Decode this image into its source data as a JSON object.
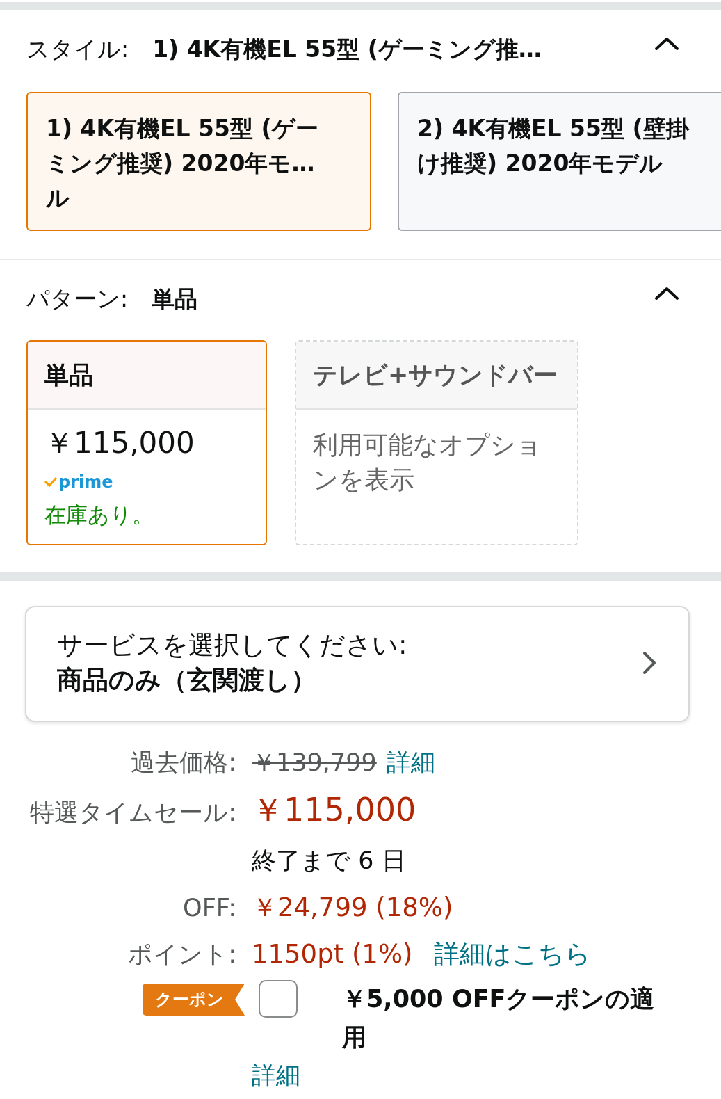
{
  "style_section": {
    "label": "スタイル:",
    "value": "1) 4K有機EL 55型 (ゲーミング推…",
    "expanded": true,
    "options": [
      {
        "text": "1) 4K有機EL 55型 (ゲーミング推奨) 2020年モ…ル",
        "selected": true
      },
      {
        "text": "2) 4K有機EL 55型 (壁掛け推奨) 2020年モデル",
        "selected": false
      }
    ]
  },
  "pattern_section": {
    "label": "パターン:",
    "value": "単品",
    "expanded": true,
    "options": [
      {
        "title": "単品",
        "selected": true,
        "available": true,
        "price": "￥115,000",
        "prime": "prime",
        "stock": "在庫あり。"
      },
      {
        "title": "テレビ+サウンドバー",
        "selected": false,
        "available": false,
        "note": "利用可能なオプションを表示"
      }
    ]
  },
  "service": {
    "prompt": "サービスを選択してください:",
    "value": "商品のみ（玄関渡し）"
  },
  "price_rows": [
    {
      "kind": "list_price",
      "label": "過去価格:",
      "value": "￥139,799",
      "link": "詳細"
    },
    {
      "kind": "sale",
      "label": "特選タイムセール:",
      "value": "￥115,000"
    },
    {
      "kind": "note",
      "value": "終了まで 6 日"
    },
    {
      "kind": "savings",
      "label": "OFF:",
      "value": "￥24,799 (18%)"
    },
    {
      "kind": "points",
      "label": "ポイント:",
      "value": "1150pt (1%)",
      "link": "詳細はこちら"
    },
    {
      "kind": "coupon",
      "badge": "クーポン",
      "checked": false,
      "value": "￥5,000 OFFクーポンの適用",
      "link": "詳細"
    }
  ]
}
